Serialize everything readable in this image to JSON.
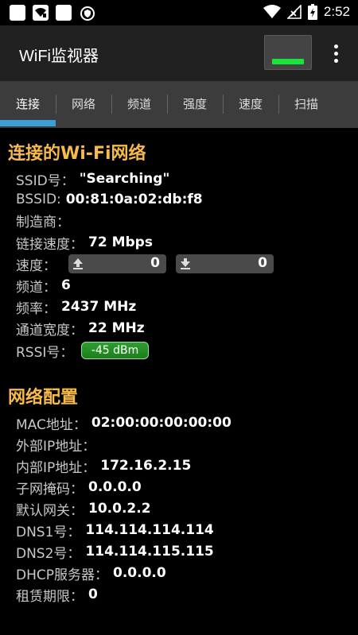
{
  "status_bar": {
    "time": "2:52"
  },
  "app": {
    "title": "WiFi监视器"
  },
  "tabs": [
    {
      "label": "连接"
    },
    {
      "label": "网络"
    },
    {
      "label": "频道"
    },
    {
      "label": "强度"
    },
    {
      "label": "速度"
    },
    {
      "label": "扫描"
    }
  ],
  "colors": {
    "accent": "#3aa0d8",
    "section_title": "#f6b94a",
    "signal": "#18e43a",
    "rssi": "#1b8f1b"
  },
  "connection": {
    "title": "连接的Wi-Fi网络",
    "ssid_label": "SSID号",
    "ssid": "\"Searching\"",
    "bssid_label": "BSSID:",
    "bssid": "00:81:0a:02:db:f8",
    "manufacturer_label": "制造商",
    "manufacturer": "",
    "link_speed_label": "链接速度",
    "link_speed": "72 Mbps",
    "speed_label": "速度",
    "upload": "0",
    "download": "0",
    "channel_label": "频道",
    "channel": "6",
    "frequency_label": "频率",
    "frequency": "2437 MHz",
    "channel_width_label": "通道宽度",
    "channel_width": "22 MHz",
    "rssi_label": "RSSI号",
    "rssi": "-45 dBm"
  },
  "network": {
    "title": "网络配置",
    "mac_label": "MAC地址",
    "mac": "02:00:00:00:00:00",
    "external_ip_label": "外部IP地址",
    "external_ip": "",
    "internal_ip_label": "内部IP地址",
    "internal_ip": "172.16.2.15",
    "subnet_label": "子网掩码",
    "subnet": "0.0.0.0",
    "gateway_label": "默认网关",
    "gateway": "10.0.2.2",
    "dns1_label": "DNS1号",
    "dns1": "114.114.114.114",
    "dns2_label": "DNS2号",
    "dns2": "114.114.115.115",
    "dhcp_label": "DHCP服务器",
    "dhcp": "0.0.0.0",
    "lease_label": "租赁期限",
    "lease": "0"
  }
}
